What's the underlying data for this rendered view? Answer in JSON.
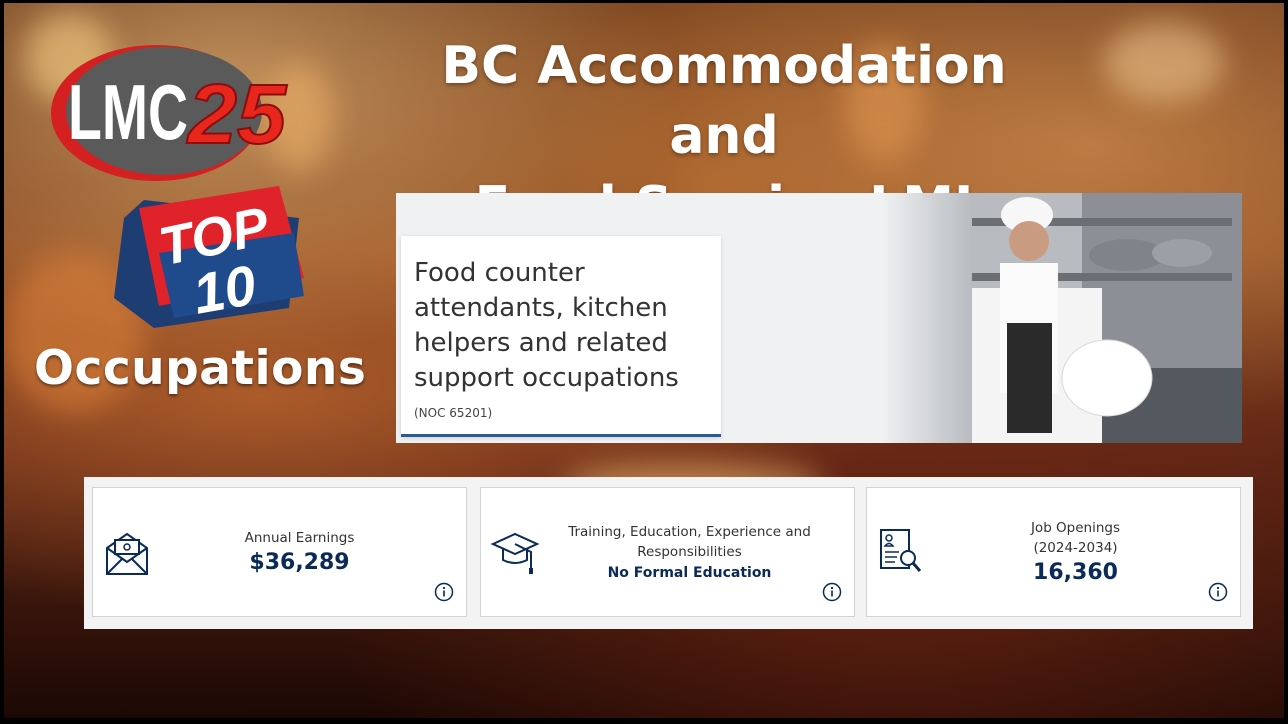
{
  "slide": {
    "title_line1": "BC Accommodation and",
    "title_line2": "Food Service LMI",
    "logo_text": "LMC25",
    "badge_top": "TOP",
    "badge_num": "10",
    "subtitle": "Occupations"
  },
  "occupation": {
    "name": "Food counter attendants, kitchen helpers and related support occupations",
    "noc": "(NOC 65201)"
  },
  "stats": {
    "earnings": {
      "label": "Annual Earnings",
      "value": "$36,289",
      "icon": "envelope-money-icon"
    },
    "training": {
      "label": "Training, Education, Experience and Responsibilities",
      "value": "No Formal Education",
      "icon": "graduation-cap-icon"
    },
    "openings": {
      "label": "Job Openings",
      "period": "(2024-2034)",
      "value": "16,360",
      "icon": "resume-search-icon"
    }
  },
  "colors": {
    "accent_navy": "#0a2a57",
    "accent_blue": "#2b5a94",
    "logo_red": "#d42020"
  }
}
